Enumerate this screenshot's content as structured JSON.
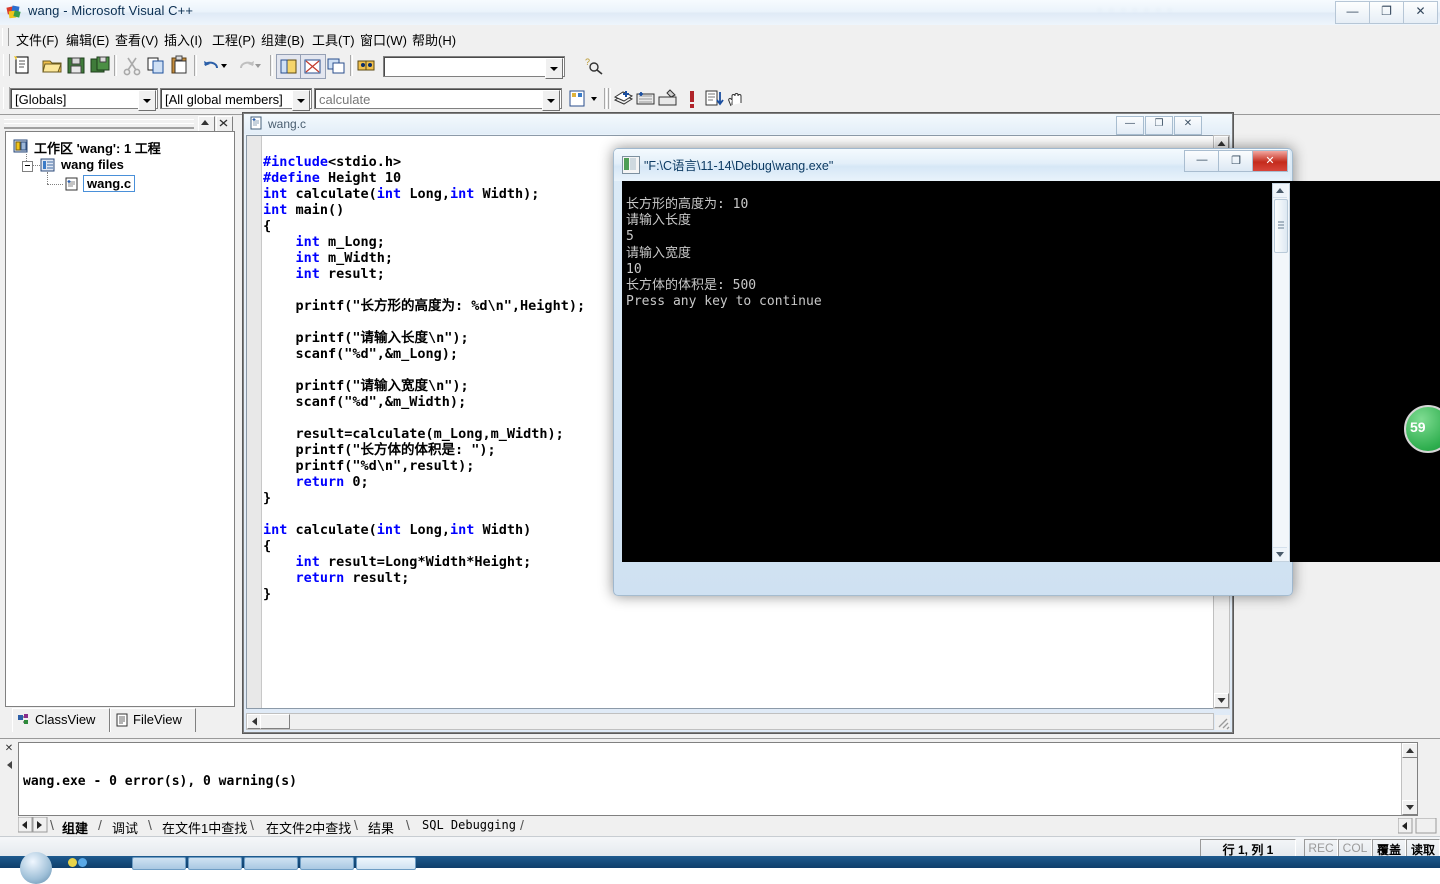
{
  "window": {
    "title": "wang - Microsoft Visual C++",
    "icon": "vcpp-app-icon",
    "controls": {
      "minimize": "—",
      "maximize": "❐",
      "close": "✕"
    },
    "watermark": "·······"
  },
  "menu": [
    {
      "label": "文件(F)",
      "name": "menu-file"
    },
    {
      "label": "编辑(E)",
      "name": "menu-edit"
    },
    {
      "label": "查看(V)",
      "name": "menu-view"
    },
    {
      "label": "插入(I)",
      "name": "menu-insert"
    },
    {
      "label": "工程(P)",
      "name": "menu-project"
    },
    {
      "label": "组建(B)",
      "name": "menu-build"
    },
    {
      "label": "工具(T)",
      "name": "menu-tools"
    },
    {
      "label": "窗口(W)",
      "name": "menu-window"
    },
    {
      "label": "帮助(H)",
      "name": "menu-help"
    }
  ],
  "toolbar_standard": {
    "find_placeholder": "",
    "find_value": ""
  },
  "toolbar_wizard": {
    "globals_value": "[Globals]",
    "members_value": "[All global members]",
    "symbol_value": "calculate"
  },
  "workspace": {
    "pane_title": "",
    "tree": [
      {
        "label": "工作区 'wang': 1 工程",
        "name": "tree-workspace-root",
        "icon": "workspace-icon"
      },
      {
        "label": "wang files",
        "name": "tree-project-wang-files",
        "icon": "project-folder-icon"
      },
      {
        "label": "wang.c",
        "name": "tree-file-wang-c",
        "icon": "c-source-icon"
      }
    ],
    "tabs": [
      {
        "label": "ClassView",
        "name": "tab-classview",
        "icon": "classview-icon"
      },
      {
        "label": "FileView",
        "name": "tab-fileview",
        "icon": "fileview-icon"
      }
    ],
    "selected_tab": "FileView"
  },
  "editor": {
    "document_title": "wang.c",
    "controls": {
      "minimize": "—",
      "restore": "❐",
      "close": "✕"
    },
    "code_lines": [
      {
        "t": "pp",
        "text": "#include<stdio.h>"
      },
      {
        "t": "pp",
        "text": "#define Height 10"
      },
      {
        "t": "mix",
        "text": "int calculate(int Long,int Width);",
        "kw": [
          "int",
          "int",
          "int"
        ]
      },
      {
        "t": "mix",
        "text": "int main()",
        "kw": [
          "int"
        ]
      },
      {
        "t": "plain",
        "text": "{"
      },
      {
        "t": "mix",
        "text": "    int m_Long;",
        "kw": [
          "int"
        ]
      },
      {
        "t": "mix",
        "text": "    int m_Width;",
        "kw": [
          "int"
        ]
      },
      {
        "t": "mix",
        "text": "    int result;",
        "kw": [
          "int"
        ]
      },
      {
        "t": "plain",
        "text": ""
      },
      {
        "t": "plain",
        "text": "    printf(\"长方形的高度为: %d\\n\",Height);"
      },
      {
        "t": "plain",
        "text": ""
      },
      {
        "t": "plain",
        "text": "    printf(\"请输入长度\\n\");"
      },
      {
        "t": "plain",
        "text": "    scanf(\"%d\",&m_Long);"
      },
      {
        "t": "plain",
        "text": ""
      },
      {
        "t": "plain",
        "text": "    printf(\"请输入宽度\\n\");"
      },
      {
        "t": "plain",
        "text": "    scanf(\"%d\",&m_Width);"
      },
      {
        "t": "plain",
        "text": ""
      },
      {
        "t": "plain",
        "text": "    result=calculate(m_Long,m_Width);"
      },
      {
        "t": "plain",
        "text": "    printf(\"长方体的体积是: \");"
      },
      {
        "t": "plain",
        "text": "    printf(\"%d\\n\",result);"
      },
      {
        "t": "mix",
        "text": "    return 0;",
        "kw": [
          "return"
        ]
      },
      {
        "t": "plain",
        "text": "}"
      },
      {
        "t": "plain",
        "text": ""
      },
      {
        "t": "mix",
        "text": "int calculate(int Long,int Width)",
        "kw": [
          "int",
          "int",
          "int"
        ]
      },
      {
        "t": "plain",
        "text": "{"
      },
      {
        "t": "mix",
        "text": "    int result=Long*Width*Height;",
        "kw": [
          "int"
        ]
      },
      {
        "t": "mix",
        "text": "    return result;",
        "kw": [
          "return"
        ]
      },
      {
        "t": "plain",
        "text": "}"
      }
    ]
  },
  "console": {
    "title": "\"F:\\C语言\\11-14\\Debug\\wang.exe\"",
    "controls": {
      "minimize": "—",
      "maximize": "❐",
      "close": "✕"
    },
    "output": "长方形的高度为: 10\n请输入长度\n5\n请输入宽度\n10\n长方体的体积是: 500\nPress any key to continue"
  },
  "output_pane": {
    "text": "wang.exe - 0 error(s), 0 warning(s)",
    "tabs": [
      {
        "label": "组建",
        "name": "output-tab-build",
        "selected": true
      },
      {
        "label": "调试",
        "name": "output-tab-debug",
        "selected": false
      },
      {
        "label": "在文件1中查找",
        "name": "output-tab-find-in-files-1",
        "selected": false
      },
      {
        "label": "在文件2中查找",
        "name": "output-tab-find-in-files-2",
        "selected": false
      },
      {
        "label": "结果",
        "name": "output-tab-results",
        "selected": false
      },
      {
        "label": "SQL Debugging",
        "name": "output-tab-sql-debugging",
        "selected": false
      }
    ]
  },
  "statusbar": {
    "position": "行 1, 列 1",
    "rec": "REC",
    "col": "COL",
    "ovr": "覆盖",
    "read": "读取"
  },
  "badge": {
    "value": "59"
  },
  "colors": {
    "keyword": "#0000ff",
    "editor_bg": "#ffffff",
    "console_bg": "#000000",
    "console_fg": "#c8c8c8",
    "accent": "#2eae4e",
    "close_red": "#c42b1c"
  }
}
